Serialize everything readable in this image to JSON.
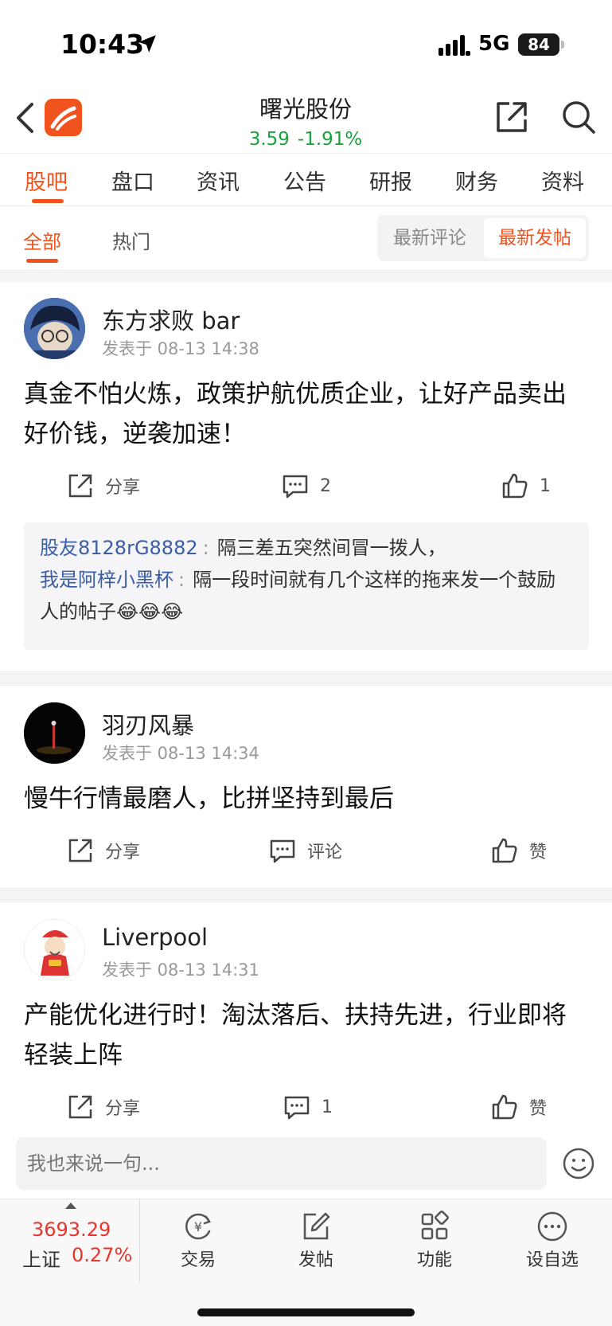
{
  "status_bar": {
    "time": "10:43",
    "network": "5G",
    "battery": "84"
  },
  "header": {
    "stock_name": "曙光股份",
    "price": "3.59",
    "change_pct": "-1.91%"
  },
  "tabs": [
    {
      "label": "股吧",
      "active": true
    },
    {
      "label": "盘口"
    },
    {
      "label": "资讯"
    },
    {
      "label": "公告"
    },
    {
      "label": "研报"
    },
    {
      "label": "财务"
    },
    {
      "label": "资料"
    }
  ],
  "subtabs": {
    "all": "全部",
    "hot": "热门",
    "sort_latest_comment": "最新评论",
    "sort_latest_post": "最新发帖"
  },
  "posts": [
    {
      "author": "东方求败 bar",
      "time": "发表于 08-13 14:38",
      "content": "真金不怕火炼，政策护航优质企业，让好产品卖出好价钱，逆袭加速！",
      "share": "分享",
      "comments": "2",
      "likes": "1",
      "replies": [
        {
          "name": "股友8128rG8882",
          "sep": ":",
          "text": "隔三差五突然间冒一拨人，"
        },
        {
          "name": "我是阿梓小黑杯",
          "sep": ":",
          "text": "隔一段时间就有几个这样的拖来发一个鼓励人的帖子😂😂😂"
        }
      ]
    },
    {
      "author": "羽刃风暴",
      "time": "发表于 08-13 14:34",
      "content": "慢牛行情最磨人，比拼坚持到最后",
      "share": "分享",
      "comments": "评论",
      "likes": "赞"
    },
    {
      "author": "Liverpool",
      "time": "发表于 08-13 14:31",
      "content": "产能优化进行时！淘汰落后、扶持先进，行业即将轻装上阵",
      "share": "分享",
      "comments": "1",
      "likes": "赞"
    }
  ],
  "comment_input": {
    "placeholder": "我也来说一句..."
  },
  "bottom_bar": {
    "index_value": "3693.29",
    "index_name": "上证",
    "index_pct": "0.27%",
    "nav": [
      "交易",
      "发帖",
      "功能",
      "设自选"
    ]
  },
  "colors": {
    "accent": "#f0531d",
    "down_green": "#1aa33a",
    "up_red": "#e8352c",
    "reply_name": "#3a5da8"
  }
}
